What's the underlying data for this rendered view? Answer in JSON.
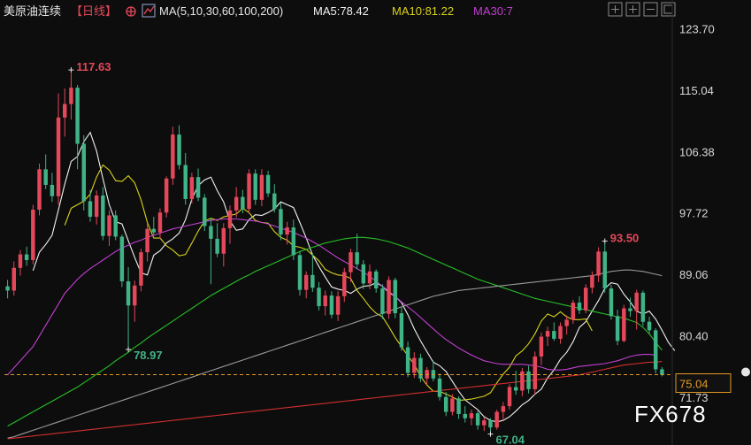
{
  "header": {
    "title": "美原油连续",
    "period": "【日线】",
    "ma_label": "MA(5,10,30,60,100,200)",
    "ma5_label": "MA5:78.42",
    "ma10_label": "MA10:81.22",
    "ma30_label": "MA30:7"
  },
  "watermark": "FX678",
  "colors": {
    "background": "#0d0d0d",
    "up": "#e5485a",
    "down": "#40b387",
    "ma5": "#f2f2f2",
    "ma10": "#d9d21c",
    "ma30": "#c13fd1",
    "ma60": "#26c026",
    "ma100": "#9a9a9a",
    "ma200": "#d22f2f",
    "price_line": "#e39a24"
  },
  "chart_data": {
    "type": "candlestick",
    "y_ticks": [
      "123.70",
      "115.04",
      "106.38",
      "97.72",
      "89.06",
      "80.40",
      "71.73"
    ],
    "ylim": [
      66.0,
      124.5
    ],
    "last_price": 75.04,
    "last_price_label": "75.04",
    "annotations": [
      {
        "label": "117.63",
        "value": 117.63,
        "index": 10,
        "kind": "high"
      },
      {
        "label": "78.97",
        "value": 78.97,
        "index": 19,
        "kind": "low"
      },
      {
        "label": "93.50",
        "value": 93.5,
        "index": 94,
        "kind": "high"
      },
      {
        "label": "67.04",
        "value": 67.04,
        "index": 76,
        "kind": "low"
      }
    ],
    "candles_ohlc": [
      [
        87.5,
        88.4,
        85.8,
        86.9
      ],
      [
        86.9,
        91.0,
        86.2,
        90.1
      ],
      [
        90.1,
        92.6,
        89.0,
        92.0
      ],
      [
        92.0,
        93.1,
        90.4,
        91.2
      ],
      [
        91.2,
        99.0,
        90.6,
        98.3
      ],
      [
        98.3,
        104.8,
        97.5,
        104.0
      ],
      [
        104.0,
        106.1,
        101.2,
        101.8
      ],
      [
        101.8,
        103.5,
        99.4,
        100.2
      ],
      [
        100.2,
        114.7,
        99.0,
        111.3
      ],
      [
        111.3,
        115.4,
        108.6,
        113.2
      ],
      [
        113.2,
        117.6,
        111.0,
        115.5
      ],
      [
        115.5,
        115.9,
        104.0,
        107.6
      ],
      [
        107.6,
        108.8,
        98.2,
        99.5
      ],
      [
        99.5,
        101.1,
        96.6,
        97.3
      ],
      [
        97.3,
        101.0,
        96.2,
        100.3
      ],
      [
        100.3,
        101.5,
        94.0,
        94.6
      ],
      [
        94.6,
        98.2,
        93.2,
        97.5
      ],
      [
        97.5,
        98.2,
        94.0,
        94.5
      ],
      [
        94.5,
        94.8,
        87.4,
        88.2
      ],
      [
        88.2,
        90.2,
        78.97,
        84.8
      ],
      [
        84.8,
        88.3,
        82.5,
        87.6
      ],
      [
        87.6,
        92.8,
        86.8,
        92.3
      ],
      [
        92.3,
        96.3,
        91.0,
        95.6
      ],
      [
        95.6,
        97.3,
        94.7,
        95.1
      ],
      [
        95.1,
        98.5,
        94.2,
        97.9
      ],
      [
        97.9,
        103.0,
        97.2,
        102.7
      ],
      [
        102.7,
        110.0,
        101.8,
        108.9
      ],
      [
        108.9,
        110.2,
        104.0,
        104.6
      ],
      [
        104.6,
        106.3,
        99.0,
        99.8
      ],
      [
        99.8,
        103.5,
        99.2,
        102.9
      ],
      [
        102.9,
        104.1,
        99.5,
        100.0
      ],
      [
        100.0,
        100.5,
        95.3,
        96.0
      ],
      [
        96.0,
        97.1,
        87.8,
        94.2
      ],
      [
        94.2,
        96.4,
        91.6,
        92.1
      ],
      [
        92.1,
        96.4,
        90.3,
        95.7
      ],
      [
        95.7,
        98.9,
        93.5,
        98.2
      ],
      [
        98.2,
        101.5,
        97.2,
        100.1
      ],
      [
        100.1,
        101.1,
        97.8,
        98.4
      ],
      [
        98.4,
        104.0,
        97.8,
        103.4
      ],
      [
        103.4,
        104.0,
        99.0,
        99.7
      ],
      [
        99.7,
        104.0,
        98.8,
        103.2
      ],
      [
        103.2,
        103.8,
        100.1,
        100.6
      ],
      [
        100.6,
        101.9,
        97.9,
        98.4
      ],
      [
        98.4,
        99.3,
        94.0,
        94.8
      ],
      [
        94.8,
        96.6,
        93.4,
        95.8
      ],
      [
        95.8,
        96.9,
        91.2,
        91.9
      ],
      [
        91.9,
        92.4,
        86.2,
        87.0
      ],
      [
        87.0,
        89.6,
        85.8,
        89.1
      ],
      [
        89.1,
        92.2,
        86.7,
        87.3
      ],
      [
        87.3,
        88.1,
        84.1,
        84.7
      ],
      [
        84.7,
        86.9,
        83.4,
        86.2
      ],
      [
        86.2,
        86.8,
        83.0,
        83.5
      ],
      [
        83.5,
        86.8,
        82.6,
        86.1
      ],
      [
        86.1,
        90.1,
        85.3,
        89.5
      ],
      [
        89.5,
        92.8,
        88.1,
        92.3
      ],
      [
        92.3,
        94.9,
        89.9,
        90.6
      ],
      [
        90.6,
        91.2,
        87.1,
        87.9
      ],
      [
        87.9,
        90.6,
        87.1,
        89.6
      ],
      [
        89.6,
        89.9,
        86.6,
        87.2
      ],
      [
        87.2,
        87.8,
        82.9,
        83.6
      ],
      [
        83.6,
        88.9,
        82.9,
        88.4
      ],
      [
        88.4,
        88.7,
        83.0,
        83.7
      ],
      [
        83.7,
        84.6,
        78.4,
        78.9
      ],
      [
        78.9,
        79.7,
        74.7,
        75.3
      ],
      [
        75.3,
        78.2,
        74.6,
        77.4
      ],
      [
        77.4,
        78.0,
        74.0,
        74.5
      ],
      [
        74.5,
        76.1,
        73.6,
        75.7
      ],
      [
        75.7,
        77.0,
        74.1,
        74.5
      ],
      [
        74.5,
        75.2,
        71.4,
        71.9
      ],
      [
        71.9,
        72.6,
        69.2,
        69.8
      ],
      [
        69.8,
        72.3,
        69.3,
        71.7
      ],
      [
        71.7,
        72.0,
        68.8,
        69.5
      ],
      [
        69.5,
        70.6,
        68.3,
        68.9
      ],
      [
        68.9,
        70.1,
        67.9,
        69.6
      ],
      [
        69.6,
        69.9,
        67.3,
        67.9
      ],
      [
        67.9,
        69.0,
        67.1,
        68.6
      ],
      [
        68.6,
        68.9,
        67.04,
        67.6
      ],
      [
        67.6,
        70.1,
        67.3,
        69.8
      ],
      [
        69.8,
        71.2,
        68.6,
        70.6
      ],
      [
        70.6,
        73.7,
        70.1,
        73.3
      ],
      [
        73.3,
        75.6,
        72.2,
        72.8
      ],
      [
        72.8,
        76.0,
        72.0,
        75.5
      ],
      [
        75.5,
        76.3,
        72.4,
        73.0
      ],
      [
        73.0,
        78.3,
        72.2,
        77.6
      ],
      [
        77.6,
        81.0,
        76.4,
        80.4
      ],
      [
        80.4,
        81.8,
        79.1,
        81.2
      ],
      [
        81.2,
        82.4,
        79.8,
        80.1
      ],
      [
        80.1,
        82.4,
        79.4,
        81.9
      ],
      [
        81.9,
        83.4,
        80.7,
        82.8
      ],
      [
        82.8,
        85.6,
        82.2,
        85.2
      ],
      [
        85.2,
        86.1,
        83.6,
        84.1
      ],
      [
        84.1,
        87.8,
        83.7,
        87.3
      ],
      [
        87.3,
        89.6,
        86.5,
        89.0
      ],
      [
        89.0,
        93.0,
        88.1,
        92.4
      ],
      [
        92.4,
        93.5,
        86.6,
        87.2
      ],
      [
        87.2,
        87.7,
        82.8,
        83.3
      ],
      [
        83.3,
        84.2,
        79.2,
        79.8
      ],
      [
        79.8,
        84.9,
        79.6,
        84.4
      ],
      [
        84.4,
        85.9,
        83.2,
        84.0
      ],
      [
        84.0,
        87.0,
        81.4,
        86.6
      ],
      [
        86.6,
        86.9,
        81.9,
        82.5
      ],
      [
        82.5,
        83.2,
        80.7,
        81.3
      ],
      [
        81.3,
        81.6,
        75.2,
        75.8
      ],
      [
        75.8,
        76.1,
        74.8,
        75.04
      ]
    ],
    "ma_series": [
      {
        "name": "MA5",
        "period": 5,
        "values_from_index": 4,
        "values": [
          89.7,
          92.3,
          93.4,
          94.7,
          98.3,
          101.9,
          105.1,
          105.8,
          107.9,
          109.2,
          106.6,
          102.7,
          99.0,
          96.6,
          96.3,
          93.9,
          91.6,
          89.4,
          89.1,
          91.9,
          92.5,
          93.6,
          94.2,
          95.0,
          96.9,
          99.8,
          101.7,
          102.5,
          102.9,
          101.0,
          99.4,
          96.7,
          95.4,
          95.6,
          96.9,
          97.6,
          97.5,
          97.9,
          98.4,
          99.4,
          99.0,
          98.6,
          96.5,
          94.3,
          91.9,
          90.3,
          88.8,
          87.4,
          87.1,
          86.9,
          86.5,
          87.1,
          87.5,
          87.6,
          88.0,
          87.5,
          86.6,
          86.1,
          85.2,
          83.5,
          81.5,
          79.8,
          78.3,
          76.8,
          76.3,
          75.5,
          74.1,
          72.7,
          71.5,
          70.8,
          70.1,
          69.1,
          68.6,
          68.4,
          68.6,
          69.1,
          69.9,
          70.8,
          71.4,
          72.3,
          73.0,
          74.6,
          75.7,
          77.2,
          78.2,
          79.7,
          81.7,
          82.5,
          84.0,
          85.5,
          87.2,
          88.0,
          87.8,
          86.4,
          85.3,
          84.0,
          83.6,
          84.0,
          82.9,
          81.3,
          79.6,
          78.42
        ]
      },
      {
        "name": "MA10",
        "period": 10,
        "values_from_index": 9,
        "values": [
          96.1,
          98.5,
          99.0,
          99.5,
          100.5,
          102.9,
          104.6,
          103.9,
          102.4,
          102.3,
          103.1,
          102.1,
          99.7,
          96.5,
          94.3,
          94.3,
          93.2,
          92.6,
          91.8,
          92.0,
          93.6,
          95.3,
          96.7,
          97.1,
          96.8,
          97.3,
          97.5,
          97.7,
          98.5,
          97.9,
          96.8,
          96.5,
          96.4,
          95.2,
          94.4,
          94.0,
          93.2,
          93.0,
          92.7,
          91.9,
          91.1,
          89.9,
          89.4,
          89.1,
          89.0,
          88.6,
          86.9,
          85.8,
          84.6,
          83.7,
          83.2,
          81.8,
          80.3,
          79.0,
          77.7,
          76.5,
          74.8,
          73.6,
          72.7,
          72.7,
          72.3,
          71.9,
          71.4,
          71.5,
          71.6,
          71.8,
          72.0,
          72.5,
          73.9,
          75.1,
          76.1,
          77.7,
          78.4,
          79.4,
          80.8,
          82.6,
          83.6,
          83.2,
          83.9,
          83.2,
          82.8,
          82.8,
          82.9,
          81.22
        ]
      },
      {
        "name": "MA30",
        "period": 30,
        "values_from_index": 0,
        "values": [
          75.0,
          76.0,
          77.0,
          78.0,
          79.0,
          80.5,
          82.0,
          83.5,
          85.0,
          86.5,
          87.5,
          88.5,
          89.3,
          90.0,
          90.6,
          91.2,
          91.8,
          92.4,
          92.9,
          93.3,
          93.7,
          94.0,
          94.4,
          94.7,
          95.0,
          95.3,
          95.6,
          95.8,
          96.0,
          96.2,
          96.4,
          96.6,
          96.8,
          96.9,
          97.0,
          97.0,
          97.0,
          96.9,
          96.8,
          96.7,
          96.5,
          96.3,
          96.0,
          95.7,
          95.4,
          95.1,
          94.7,
          94.3,
          93.8,
          93.3,
          92.7,
          92.1,
          91.5,
          91.0,
          90.5,
          90.0,
          89.5,
          88.9,
          88.2,
          87.5,
          86.8,
          86.1,
          85.3,
          84.6,
          83.9,
          83.1,
          82.3,
          81.5,
          80.7,
          80.0,
          79.4,
          78.8,
          78.3,
          77.8,
          77.4,
          77.0,
          76.8,
          76.6,
          76.5,
          76.5,
          76.5,
          76.5,
          76.4,
          76.3,
          76.1,
          75.8,
          75.7,
          75.7,
          75.8,
          76.0,
          76.2,
          76.3,
          76.4,
          76.5,
          76.6,
          76.8,
          77.0,
          77.3,
          77.6,
          77.8,
          77.9,
          77.9,
          77.8
        ]
      },
      {
        "name": "MA60",
        "period": 60,
        "values_from_index": 0,
        "values": [
          67.8,
          68.3,
          68.8,
          69.3,
          69.8,
          70.3,
          70.8,
          71.3,
          71.8,
          72.3,
          72.8,
          73.3,
          73.9,
          74.5,
          75.1,
          75.7,
          76.3,
          77.0,
          77.6,
          78.2,
          78.9,
          79.5,
          80.2,
          80.8,
          81.4,
          82.0,
          82.6,
          83.2,
          83.8,
          84.4,
          85.0,
          85.6,
          86.2,
          86.7,
          87.2,
          87.7,
          88.2,
          88.7,
          89.1,
          89.6,
          90.0,
          90.4,
          90.8,
          91.2,
          91.6,
          92.0,
          92.4,
          92.7,
          93.0,
          93.3,
          93.6,
          93.8,
          94.0,
          94.2,
          94.3,
          94.4,
          94.4,
          94.3,
          94.2,
          94.0,
          93.8,
          93.5,
          93.2,
          92.9,
          92.5,
          92.1,
          91.7,
          91.3,
          90.9,
          90.5,
          90.1,
          89.7,
          89.3,
          88.9,
          88.5,
          88.2,
          87.9,
          87.6,
          87.3,
          87.0,
          86.7,
          86.4,
          86.1,
          85.8,
          85.6,
          85.4,
          85.2,
          85.0,
          84.8,
          84.6,
          84.4,
          84.2,
          84.0,
          83.8,
          83.6,
          83.4,
          83.2,
          83.0,
          82.7,
          82.4,
          81.7,
          80.8,
          79.6,
          78.5
        ]
      },
      {
        "name": "MA100",
        "period": 100,
        "values_from_index": 0,
        "values": [
          66.1,
          66.3,
          66.6,
          66.9,
          67.2,
          67.5,
          67.8,
          68.1,
          68.4,
          68.7,
          69.0,
          69.3,
          69.6,
          69.9,
          70.2,
          70.5,
          70.8,
          71.1,
          71.4,
          71.7,
          72.0,
          72.3,
          72.6,
          72.9,
          73.2,
          73.5,
          73.8,
          74.1,
          74.4,
          74.7,
          75.0,
          75.3,
          75.6,
          75.9,
          76.2,
          76.5,
          76.8,
          77.1,
          77.4,
          77.7,
          78.0,
          78.3,
          78.6,
          78.9,
          79.2,
          79.5,
          79.8,
          80.1,
          80.4,
          80.7,
          81.0,
          81.3,
          81.6,
          81.9,
          82.2,
          82.5,
          82.8,
          83.1,
          83.4,
          83.7,
          84.0,
          84.3,
          84.6,
          84.9,
          85.2,
          85.5,
          85.8,
          86.1,
          86.3,
          86.5,
          86.7,
          86.9,
          87.0,
          87.1,
          87.2,
          87.3,
          87.4,
          87.5,
          87.6,
          87.7,
          87.8,
          87.9,
          88.0,
          88.1,
          88.2,
          88.3,
          88.4,
          88.5,
          88.6,
          88.7,
          88.8,
          88.9,
          89.0,
          89.2,
          89.4,
          89.6,
          89.7,
          89.8,
          89.8,
          89.7,
          89.6,
          89.4,
          89.2,
          89.0
        ]
      },
      {
        "name": "MA200",
        "period": 200,
        "values_from_index": 0,
        "values": [
          66.0,
          66.1,
          66.2,
          66.3,
          66.4,
          66.5,
          66.6,
          66.7,
          66.8,
          66.9,
          67.0,
          67.1,
          67.2,
          67.3,
          67.4,
          67.5,
          67.6,
          67.7,
          67.8,
          67.9,
          68.0,
          68.1,
          68.2,
          68.3,
          68.4,
          68.5,
          68.6,
          68.7,
          68.8,
          68.9,
          69.0,
          69.1,
          69.2,
          69.3,
          69.4,
          69.5,
          69.6,
          69.7,
          69.8,
          69.9,
          70.0,
          70.1,
          70.2,
          70.3,
          70.4,
          70.5,
          70.6,
          70.7,
          70.8,
          70.9,
          71.0,
          71.1,
          71.2,
          71.3,
          71.4,
          71.5,
          71.6,
          71.7,
          71.8,
          71.9,
          72.0,
          72.1,
          72.2,
          72.3,
          72.4,
          72.5,
          72.6,
          72.7,
          72.8,
          72.9,
          73.0,
          73.1,
          73.2,
          73.3,
          73.4,
          73.5,
          73.6,
          73.7,
          73.8,
          73.9,
          74.0,
          74.1,
          74.2,
          74.3,
          74.4,
          74.5,
          74.6,
          74.7,
          74.8,
          74.9,
          75.0,
          75.2,
          75.4,
          75.6,
          75.8,
          76.0,
          76.2,
          76.4,
          76.5,
          76.6,
          76.7,
          76.8,
          76.8,
          76.9
        ]
      }
    ]
  }
}
